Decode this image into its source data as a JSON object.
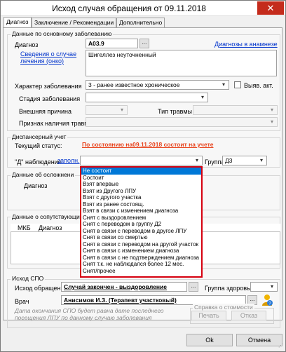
{
  "window": {
    "title": "Исход случая обращения от 09.11.2018",
    "close_glyph": "✕"
  },
  "tabs": [
    "Диагноз",
    "Заключение / Рекомендации",
    "Дополнительно"
  ],
  "main_disease": {
    "group_title": "Данные по основному заболеванию",
    "diagnosis_label": "Диагноз",
    "diagnosis_code": "A03.9",
    "diagnosis_lookup_glyph": "...",
    "anamnesis_link": "Диагнозы в анамнезе",
    "case_info_link": "Сведения о случае лечения (онко)",
    "diagnosis_text": "Шигеллез неуточненный",
    "nature_label": "Характер заболевания",
    "nature_value": "3 - ранее известное хроническое",
    "vyyav_label": "Выяв. акт.",
    "stage_label": "Стадия заболевания",
    "stage_value": "",
    "external_cause_label": "Внешняя причина",
    "injury_type_label": "Тип травмы",
    "injury_sign_label": "Признак наличия травмы"
  },
  "dispensary": {
    "group_title": "Диспансерный учет",
    "current_status_label": "Текущий статус:",
    "current_status_value": "По состоянию на09.11.2018 состоит на учете",
    "observation_label": "\"Д\" наблюдение",
    "fill_link": "заполн.",
    "observation_value": "",
    "group_label": "Группа",
    "group_value": "Д3",
    "options": [
      "Не состоит",
      "Состоит",
      "Взят впервые",
      "Взят из Другого ЛПУ",
      "Взят с другого участка",
      "Взят из ранее состоящ.",
      "Взят в связи с изменением диагноза",
      "Снят с выздоровлением",
      "Снят с переводом в группу Д2",
      "Снят в связи с переводом в другое ЛПУ",
      "Снят в связи со смертью",
      "Снят в связи с переводом на другой участок",
      "Снят в связи с изменением диагноза",
      "Снят в связи с не подтверждением диагноза",
      "Снят т.к. не наблюдался более 12 мес.",
      "Снят/прочее"
    ],
    "selected_index": 0
  },
  "complications": {
    "group_title": "Данные об осложнени",
    "diagnosis_label": "Диагноз"
  },
  "comorbid": {
    "group_title": "Данные о сопутствующих",
    "col_mkb": "МКБ",
    "col_diagnosis": "Диагноз"
  },
  "spo": {
    "group_title": "Исход СПО",
    "outcome_label": "Исход обращения",
    "outcome_value": "Случай закончен - выздоровление",
    "health_group_label": "Группа здоровья",
    "doctor_label": "Врач",
    "doctor_value": "Анисимов И.З. (Терапевт участковый)",
    "note": "Дата окончания СПО будет равна дате последнего посещения ЛПУ по данному случаю заболевания",
    "cost_group_title": "Справка о стоимости",
    "print_label": "Печать",
    "refuse_label": "Отказ"
  },
  "footer": {
    "ok_label": "Ok",
    "cancel_label": "Отмена"
  },
  "colors": {
    "selection": "#0078d7",
    "status_red": "#e8441e",
    "link": "#0033cc",
    "highlight_border": "#d6000f"
  }
}
